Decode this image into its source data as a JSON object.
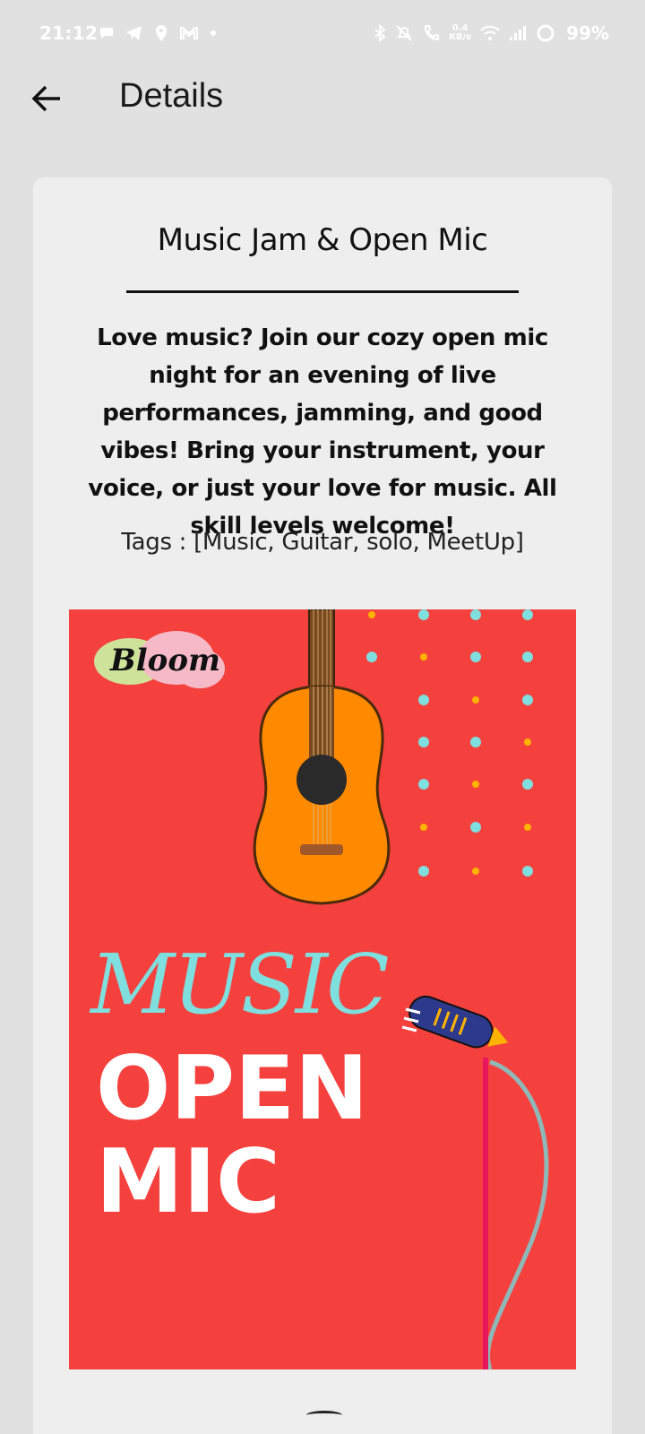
{
  "status_bar": {
    "time": "21:12",
    "net_speed_value": "0.4",
    "net_speed_unit": "KB/s",
    "battery": "99%",
    "left_icons": [
      "chat-bubble-icon",
      "telegram-icon",
      "location-icon",
      "gmail-icon",
      "dot-icon"
    ],
    "right_icons": [
      "bluetooth-icon",
      "mute-icon",
      "call-icon",
      "wifi-icon",
      "signal-icon",
      "battery-icon"
    ]
  },
  "app_bar": {
    "title": "Details",
    "back_icon": "arrow-left-icon"
  },
  "event": {
    "title": "Music Jam & Open Mic",
    "description": "Love music? Join our cozy open mic night for an evening of live performances, jamming, and good vibes! Bring your instrument, your voice, or just your love for music. All skill levels welcome!",
    "tags_text": "Tags : [Music, Guitar, solo, MeetUp]",
    "poster": {
      "brand": "Bloom",
      "line1": "MUSIC",
      "line2": "OPEN",
      "line3": "MIC",
      "background_color": "#f4413e",
      "accent_cyan": "#7fdede",
      "accent_orange": "#ff8a00",
      "accent_yellow": "#ffb300"
    }
  },
  "colors": {
    "page_background": "#e1e1e1",
    "card_background": "#eeeeee",
    "text": "#111111"
  }
}
